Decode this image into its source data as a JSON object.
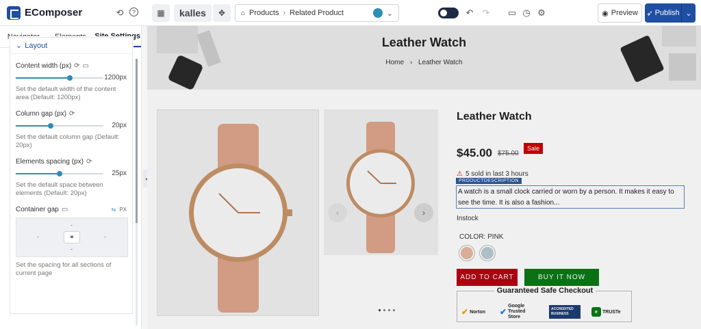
{
  "app": {
    "name": "EComposer",
    "theme_label": "kalles",
    "breadcrumb": [
      "Products",
      "Related Product"
    ],
    "preview_label": "Preview",
    "publish_label": "Publish",
    "colors": {
      "brand": "#1f4fa3",
      "accent": "#2b8fb5",
      "sale": "#cc0000",
      "buy": "#0b7a17"
    }
  },
  "sidebar": {
    "tabs": [
      {
        "label": "Navigator",
        "active": false
      },
      {
        "label": "Elements",
        "active": false
      },
      {
        "label": "Site Settings",
        "active": true
      }
    ],
    "section_title": "Layout",
    "settings": {
      "content_width": {
        "label": "Content width (px)",
        "value": "1200px",
        "level": 0.62,
        "desc": "Set the default width of the content area (Default: 1200px)"
      },
      "column_gap": {
        "label": "Column gap (px)",
        "value": "20px",
        "level": 0.4,
        "desc": "Set the default column gap (Default: 20px)"
      },
      "elements_spacing": {
        "label": "Elements spacing (px)",
        "value": "25px",
        "level": 0.5,
        "desc": "Set the default space between elements (Default: 20px)"
      },
      "container_gap": {
        "label": "Container gap",
        "unit": "PX",
        "top": "-",
        "right": "-",
        "bottom": "-",
        "left": "-",
        "desc": "Set the spacing for all sections of current page"
      }
    }
  },
  "canvas": {
    "hero_title": "Leather Watch",
    "hero_crumb_home": "Home",
    "hero_crumb_current": "Leather Watch",
    "product": {
      "title": "Leather Watch",
      "price": "$45.00",
      "old_price": "$75.00",
      "sale_badge": "Sale",
      "sold_text": "5 sold in last 3 hours",
      "desc_tag": "PRODUCTDESCRIPTION",
      "description": "A watch is a small clock carried or worn by a person. It makes it easy to see the time. It is also a fashion...",
      "stock": "Instock",
      "color_label": "COLOR: PINK",
      "swatches": [
        "#e8b8a0",
        "#b9ccd2"
      ],
      "add_to_cart": "ADD TO CART",
      "buy_now": "BUY IT NOW",
      "checkout_title": "Guaranteed Safe Checkout",
      "badges": [
        "Norton",
        "Google Trusted Store",
        "ACCREDITED BUSINESS",
        "TRUSTe"
      ]
    }
  }
}
